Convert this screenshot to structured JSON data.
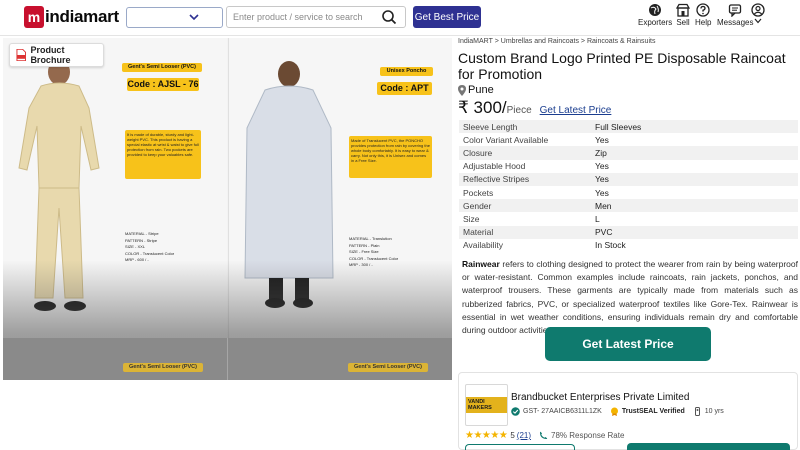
{
  "header": {
    "logo_text": "indiamart",
    "search_placeholder": "Enter product / service to search",
    "best_price_label": "Get Best Price",
    "nav": [
      {
        "label": "Exporters",
        "icon": "globe-icon"
      },
      {
        "label": "Sell",
        "icon": "store-icon"
      },
      {
        "label": "Help",
        "icon": "help-icon"
      },
      {
        "label": "Messages",
        "icon": "messages-icon"
      },
      {
        "label": "",
        "icon": "user-icon"
      }
    ]
  },
  "gallery": {
    "brochure_label": "Product Brochure",
    "left": {
      "name_tag": "Gent's Semi Looser (PVC)",
      "code": "Code : AJSL - 76",
      "info": "It is made of durable, sturdy and light-weight PVC. This product is having a special elastic at wrist & waist to give full protection from rain. Two pockets are provided to keep your valuables safe.",
      "spec_lines": [
        "MATERIAL  -  Stripe",
        "PATTERN  -  Stripe",
        "SIZE  -  XXL",
        "COLOR  -  Translucent Color",
        "MRP  -  600 / -"
      ],
      "lower_tag": "Gent's Semi Looser (PVC)"
    },
    "right": {
      "name_tag": "Unisex Poncho",
      "code": "Code : APT",
      "info": "Made of Translucent PVC, the PONCHO provides protection from rain by covering the whole body comfortably. It is easy to wear & carry. Not only this, it is Unisex and comes in a Free Size.",
      "spec_lines": [
        "MATERIAL  -  Translution",
        "PATTERN  -  Plain",
        "SIZE  -  Free Size",
        "COLOR  -  Translucent Color",
        "MRP  -  300 / -"
      ],
      "lower_tag": "Gent's Semi Looser (PVC)"
    }
  },
  "product": {
    "breadcrumb": [
      "IndiaMART",
      "Umbrellas and Raincoats",
      "Raincoats & Rainsuits"
    ],
    "title": "Custom Brand Logo Printed PE Disposable Raincoat for Promotion",
    "location": "Pune",
    "price": "₹ 300/",
    "price_unit": "Piece",
    "latest_price_link": "Get Latest Price",
    "specs": [
      {
        "label": "Sleeve Length",
        "value": "Full Sleeves"
      },
      {
        "label": "Color Variant Available",
        "value": "Yes"
      },
      {
        "label": "Closure",
        "value": "Zip"
      },
      {
        "label": "Adjustable Hood",
        "value": "Yes"
      },
      {
        "label": "Reflective Stripes",
        "value": "Yes"
      },
      {
        "label": "Pockets",
        "value": "Yes"
      },
      {
        "label": "Gender",
        "value": "Men"
      },
      {
        "label": "Size",
        "value": "L"
      },
      {
        "label": "Material",
        "value": "PVC"
      },
      {
        "label": "Availability",
        "value": "In Stock"
      }
    ],
    "description_lead": "Rainwear",
    "description": " refers to clothing designed to protect the wearer from rain by being waterproof or water-resistant. Common examples include raincoats, rain jackets, ponchos, and waterproof trousers. These garments are typically made from materials such as rubberized fabrics, PVC, or specialized waterproof textiles like Gore-Tex. Rainwear is essential in wet weather conditions, ensuring individuals remain dry and comfortable during outdoor activities.",
    "cta_label": "Get Latest Price"
  },
  "seller": {
    "logo_text": "VANDI MAKERS",
    "name": "Brandbucket Enterprises Private Limited",
    "gst": "GST- 27AAICB6311L1ZK",
    "trustseal": "TrustSEAL Verified",
    "years": "10 yrs",
    "stars": "★★★★★",
    "rating": "5",
    "rating_count": "(21)",
    "response_rate": "78% Response Rate"
  },
  "colors": {
    "brand_navy": "#2e3192",
    "cta_green": "#0f7a6e",
    "tag_yellow": "#f7c21a",
    "link_blue": "#1a3d8f"
  }
}
